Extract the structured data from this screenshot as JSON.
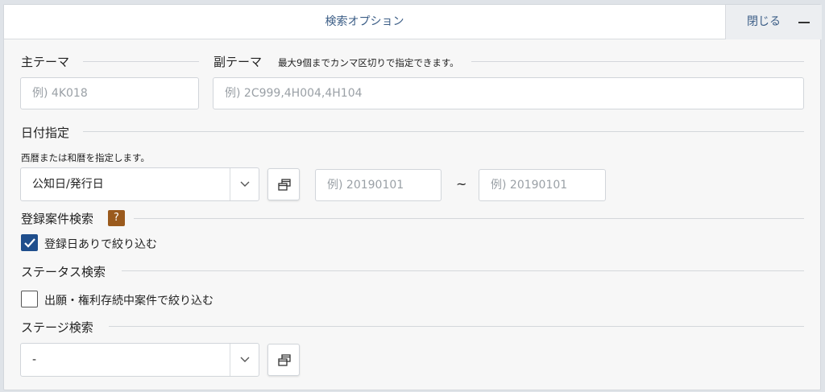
{
  "header": {
    "title": "検索オプション",
    "close_label": "閉じる"
  },
  "main_theme": {
    "title": "主テーマ",
    "placeholder": "例) 4K018"
  },
  "sub_theme": {
    "title": "副テーマ",
    "note": "最大9個までカンマ区切りで指定できます。",
    "placeholder": "例) 2C999,4H004,4H104"
  },
  "date": {
    "title": "日付指定",
    "note": "西暦または和暦を指定します。",
    "type_value": "公知日/発行日",
    "from_placeholder": "例) 20190101",
    "to_placeholder": "例) 20190101",
    "separator": "~"
  },
  "registered": {
    "title": "登録案件検索",
    "help": "?",
    "checkbox_label": "登録日ありで絞り込む",
    "checked": true
  },
  "status": {
    "title": "ステータス検索",
    "checkbox_label": "出願・権利存続中案件で絞り込む",
    "checked": false
  },
  "stage": {
    "title": "ステージ検索",
    "value": "-"
  },
  "colors": {
    "accent": "#1f4e8c",
    "title_blue": "#3b5d86",
    "help_badge": "#9a5a1d"
  }
}
